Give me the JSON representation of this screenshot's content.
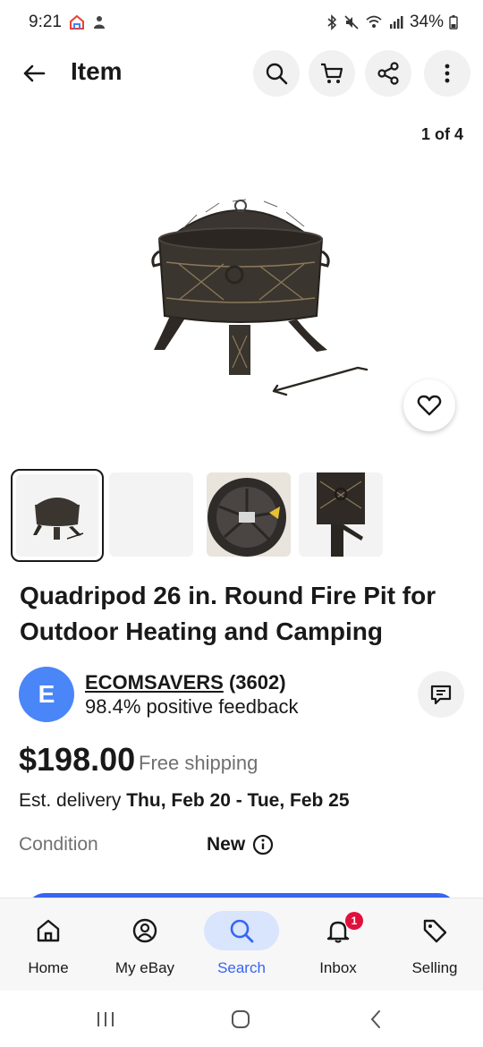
{
  "status_bar": {
    "time": "9:21",
    "battery": "34%"
  },
  "header": {
    "title": "Item"
  },
  "gallery": {
    "counter": "1 of 4",
    "thumbnail_count": 4
  },
  "listing": {
    "title": "Quadripod 26 in. Round Fire Pit for Outdoor Heating and Camping",
    "price": "$198.00",
    "shipping": "Free shipping",
    "delivery_prefix": "Est. delivery",
    "delivery_dates": "Thu, Feb 20 - Tue, Feb 25",
    "condition_label": "Condition",
    "condition_value": "New"
  },
  "seller": {
    "initial": "E",
    "username": "ECOMSAVERS",
    "score": "(3602)",
    "feedback": "98.4% positive feedback"
  },
  "bottom_nav": {
    "items": [
      {
        "label": "Home",
        "icon": "home-icon"
      },
      {
        "label": "My eBay",
        "icon": "user-icon"
      },
      {
        "label": "Search",
        "icon": "search-icon",
        "active": true
      },
      {
        "label": "Inbox",
        "icon": "bell-icon",
        "badge": "1"
      },
      {
        "label": "Selling",
        "icon": "tag-icon"
      }
    ]
  },
  "colors": {
    "accent": "#3665f3",
    "active_pill": "#d9e4fd",
    "badge": "#e0103a",
    "avatar": "#4a86f7"
  }
}
